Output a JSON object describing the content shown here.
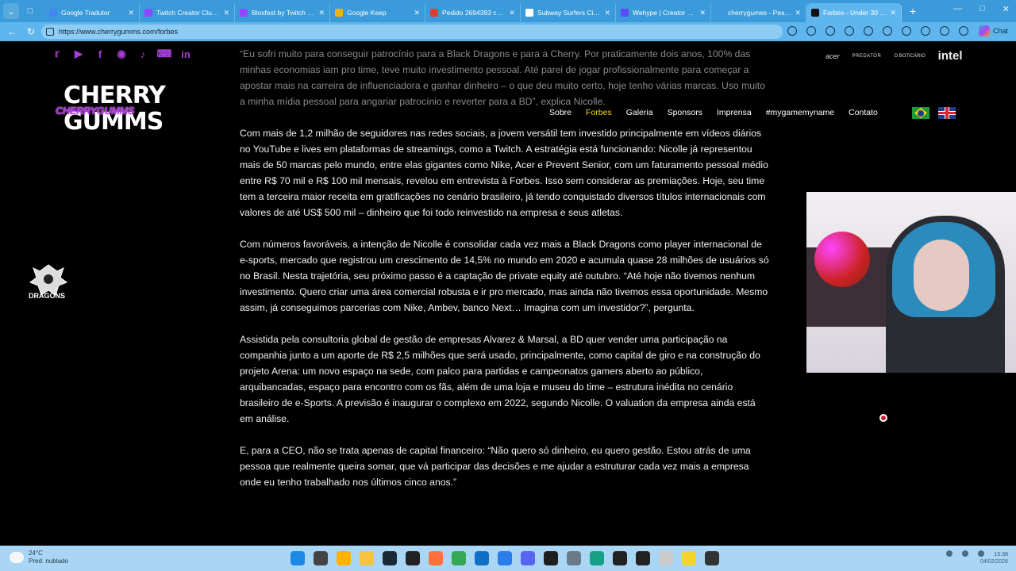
{
  "browser": {
    "tabs": [
      {
        "label": "Google Tradutor",
        "color": "#4285f4"
      },
      {
        "label": "Twitch Creator Clubs - /",
        "color": "#9146ff"
      },
      {
        "label": "Bloxfest by Twitch - Co",
        "color": "#9146ff"
      },
      {
        "label": "Google Keep",
        "color": "#f4b400"
      },
      {
        "label": "Pedido 2694393 confirm",
        "color": "#e53935"
      },
      {
        "label": "Subway Surfers City La",
        "color": "#ffffff"
      },
      {
        "label": "Wehype | Creator Collab",
        "color": "#5b4bff"
      },
      {
        "label": "cherrygumes - Pesquisa",
        "color": "#3b9ad9"
      },
      {
        "label": "Forbes - Under 30 - Ch",
        "color": "#111111",
        "active": true
      }
    ],
    "url": "https://www.cherrygumms.com/forbes",
    "profile_label": "Chat"
  },
  "site": {
    "logo": {
      "big_text": "CHERRY\nGUMMS",
      "script_text": "CHERRYGUMMS"
    },
    "social_icons": [
      "twitter-icon",
      "youtube-icon",
      "facebook-icon",
      "instagram-icon",
      "tiktok-icon",
      "twitch-icon",
      "linkedin-icon"
    ],
    "sponsors": [
      "acer",
      "PREDATOR",
      "O BOTICÁRIO",
      "intel"
    ],
    "nav": [
      {
        "label": "Sobre",
        "active": false
      },
      {
        "label": "Forbes",
        "active": true
      },
      {
        "label": "Galeria",
        "active": false
      },
      {
        "label": "Sponsors",
        "active": false
      },
      {
        "label": "Imprensa",
        "active": false
      },
      {
        "label": "#mygamemyname",
        "active": false
      },
      {
        "label": "Contato",
        "active": false
      }
    ],
    "team_badge": "DRAGONS",
    "accent_color": "#f5d327"
  },
  "article": {
    "paragraphs": [
      "“Eu sofri muito para conseguir patrocínio para a Black Dragons e para a Cherry. Por praticamente dois anos, 100% das minhas economias iam pro time, teve muito investimento pessoal. Até parei de jogar profissionalmente para começar a apostar mais na carreira de influenciadora e ganhar dinheiro – o que deu muito certo, hoje tenho várias marcas. Uso muito a minha mídia pessoal para angariar patrocínio e reverter para a BD”, explica Nicolle.",
      "Com mais de 1,2 milhão de seguidores nas redes sociais, a jovem versátil tem investido principalmente em vídeos diários no YouTube e lives em plataformas de streamings, como a Twitch. A estratégia está funcionando: Nicolle já representou mais de 50 marcas pelo mundo, entre elas gigantes como Nike, Acer e Prevent Senior, com um faturamento pessoal médio entre R$ 70 mil e R$ 100 mil mensais, revelou em entrevista à Forbes. Isso sem considerar as premiações. Hoje, seu time tem a terceira maior receita em gratificações no cenário brasileiro, já tendo conquistado diversos títulos internacionais com valores de até US$ 500 mil – dinheiro que foi todo reinvestido na empresa e seus atletas.",
      "Com números favoráveis, a intenção de Nicolle é consolidar cada vez mais a Black Dragons como player internacional de e-sports, mercado que registrou um crescimento de 14,5% no mundo em 2020 e acumula quase 28 milhões de usuários só no Brasil. Nesta trajetória, seu próximo passo é a captação de private equity até outubro. “Até hoje não tivemos nenhum investimento. Quero criar uma área comercial robusta e ir pro mercado, mas ainda não tivemos essa oportunidade. Mesmo assim, já conseguimos parcerias com Nike, Ambev, banco Next… Imagina com um investidor?”, pergunta.",
      "Assistida pela consultoria global de gestão de empresas Alvarez & Marsal, a BD quer vender uma participação na companhia junto a um aporte de R$ 2,5 milhões que será usado, principalmente, como capital de giro e na construção do projeto Arena: um novo espaço na sede, com palco para partidas e campeonatos gamers aberto ao público, arquibancadas, espaço para encontro com os fãs, além de uma loja e museu do time – estrutura inédita no cenário brasileiro de e-Sports.  A previsão é inaugurar o complexo  em 2022, segundo Nicolle. O valuation da empresa ainda está em análise.",
      "E, para a CEO, não se trata apenas de capital financeiro: “Não quero só dinheiro, eu quero gestão. Estou atrás de uma pessoa que realmente queira somar, que vá participar das decisões e me ajudar a estruturar cada vez mais a empresa onde eu tenho trabalhado nos últimos cinco anos.”"
    ]
  },
  "taskbar": {
    "weather_temp": "24°C",
    "weather_desc": "Pred. nublado",
    "apps": [
      "#1e88e5",
      "#444444",
      "#ffb300",
      "#f6c343",
      "#1b2838",
      "#222222",
      "#ff7139",
      "#34a853",
      "#0f6fc6",
      "#2b7de9",
      "#5865f2",
      "#1e1e1e",
      "#6a7a88",
      "#14a085",
      "#222222",
      "#222222",
      "#cccccc",
      "#f5d327",
      "#333333"
    ],
    "clock_time": "15:38",
    "clock_date": "04/02/2026"
  }
}
